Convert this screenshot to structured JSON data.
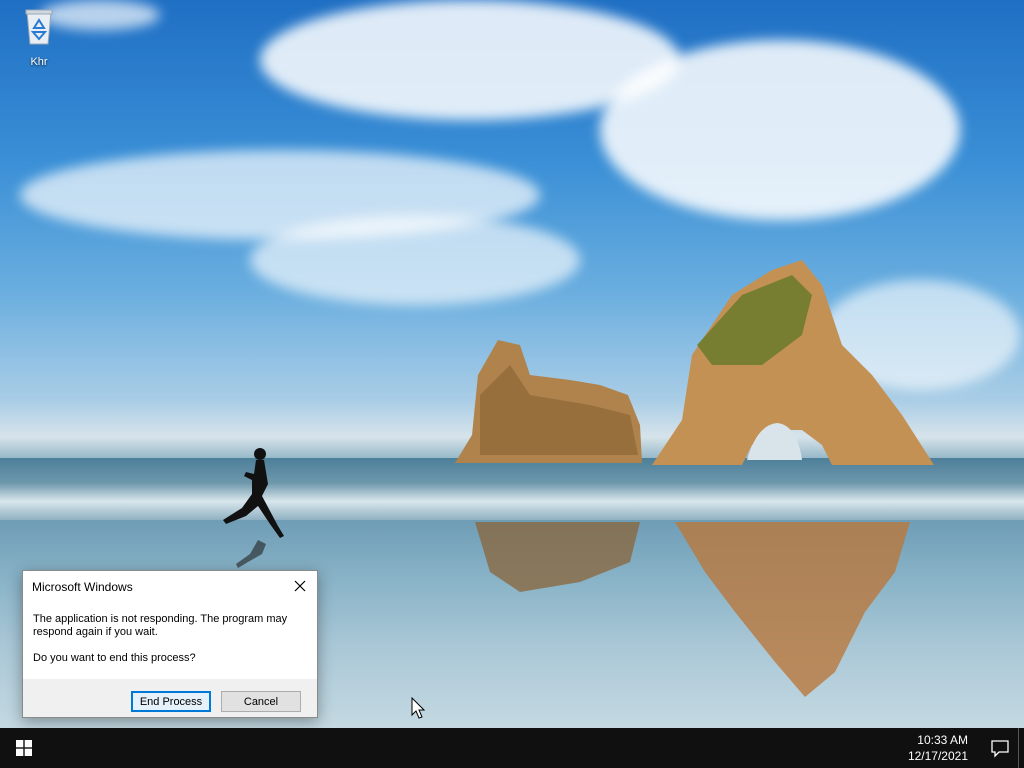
{
  "desktop": {
    "icons": [
      {
        "label": "Khr",
        "icon": "recycle-bin-icon"
      }
    ]
  },
  "dialog": {
    "title": "Microsoft Windows",
    "message": "The application is not responding. The program may respond again if you wait.",
    "question": "Do you want to end this process?",
    "buttons": {
      "end_process": "End Process",
      "cancel": "Cancel"
    },
    "accent_color": "#0078d7"
  },
  "taskbar": {
    "start_icon": "windows-logo-icon",
    "time": "10:33 AM",
    "date": "12/17/2021",
    "notification_icon": "action-center-icon"
  }
}
